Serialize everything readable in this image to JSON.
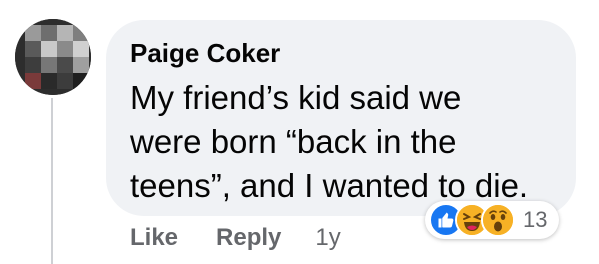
{
  "comment": {
    "author": "Paige Coker",
    "text_lines": [
      "My friend’s kid said we",
      "were born “back in the",
      "teens”, and I wanted to die."
    ],
    "actions": {
      "like_label": "Like",
      "reply_label": "Reply",
      "timestamp": "1y"
    },
    "reactions": {
      "icons": [
        "like-icon",
        "haha-icon",
        "wow-icon"
      ],
      "count": "13"
    }
  },
  "colors": {
    "bubble": "#f0f2f5",
    "text": "#050505",
    "secondary_text": "#65676b",
    "like_blue": "#1877f2",
    "emoji_yellow": "#f7b125"
  }
}
